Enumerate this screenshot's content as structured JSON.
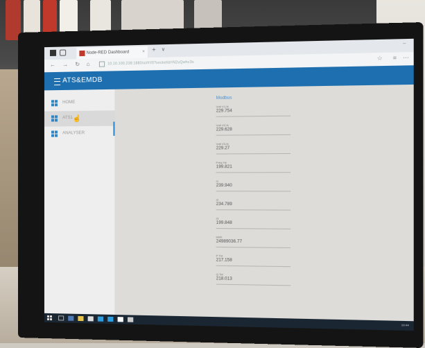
{
  "browser": {
    "tab_title": "Node-RED Dashboard",
    "tab_close": "×",
    "new_tab": "+",
    "tab_dropdown": "∨",
    "url": "10.10.100.238:1880/ui/#!/0?socketid=N2uQwhc3s",
    "nav": {
      "back": "←",
      "forward": "→",
      "reload": "↻",
      "home": "⌂"
    }
  },
  "app": {
    "title": "ATS&EMDB"
  },
  "sidebar": {
    "items": [
      {
        "label": "HOME"
      },
      {
        "label": "ATS1"
      },
      {
        "label": "ANALYSER"
      }
    ]
  },
  "content": {
    "section_title": "Modbus",
    "fields": [
      {
        "label": "Volt V1-N",
        "value": "229.754"
      },
      {
        "label": "Volt V2-N",
        "value": "229.628"
      },
      {
        "label": "Volt V3-N",
        "value": "229.27"
      },
      {
        "label": "Freq Hz",
        "value": "199.821"
      },
      {
        "label": "I1",
        "value": "239.940"
      },
      {
        "label": "I2",
        "value": "234.789"
      },
      {
        "label": "I3",
        "value": "199.848"
      },
      {
        "label": "kWh",
        "value": "24989036.77"
      },
      {
        "label": "P Tot",
        "value": "217.158"
      },
      {
        "label": "Q Tot",
        "value": "218.013"
      }
    ]
  },
  "taskbar": {
    "time": "10:44"
  },
  "colors": {
    "accent": "#1e6fb0",
    "sidebar_icon": "#2c86c8"
  }
}
